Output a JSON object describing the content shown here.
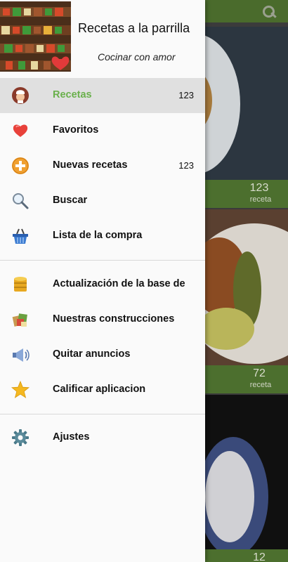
{
  "drawer": {
    "title": "Recetas a la parrilla",
    "subtitle": "Cocinar con amor",
    "sections": [
      [
        {
          "label": "Recetas",
          "count": "123",
          "icon": "chef-icon",
          "active": true
        },
        {
          "label": "Favoritos",
          "count": "",
          "icon": "heart-icon"
        },
        {
          "label": "Nuevas recetas",
          "count": "123",
          "icon": "plus-badge-icon"
        },
        {
          "label": "Buscar",
          "count": "",
          "icon": "search-icon"
        },
        {
          "label": "Lista de la compra",
          "count": "",
          "icon": "basket-icon"
        }
      ],
      [
        {
          "label": "Actualización de la base de",
          "count": "",
          "icon": "database-icon"
        },
        {
          "label": "Nuestras construcciones",
          "count": "",
          "icon": "apps-icon"
        },
        {
          "label": "Quitar anuncios",
          "count": "",
          "icon": "megaphone-icon"
        },
        {
          "label": "Calificar aplicacion",
          "count": "",
          "icon": "star-icon"
        }
      ],
      [
        {
          "label": "Ajustes",
          "count": "",
          "icon": "gear-icon"
        }
      ]
    ]
  },
  "background": {
    "cards": [
      {
        "count": "123",
        "unit": "receta"
      },
      {
        "count": "72",
        "unit": "receta"
      },
      {
        "count": "12",
        "unit": ""
      }
    ]
  },
  "colors": {
    "accent": "#6ab04c",
    "active_bg": "#e0e0e0",
    "drawer_bg": "#fafafa"
  }
}
